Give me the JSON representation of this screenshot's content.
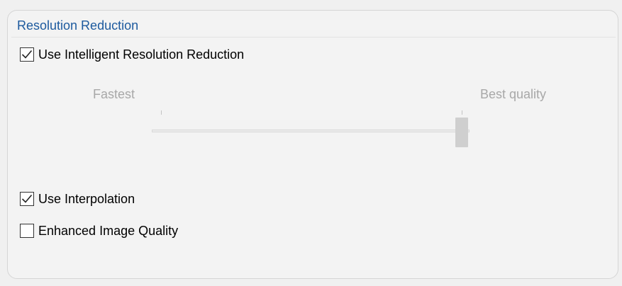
{
  "group": {
    "title": "Resolution Reduction"
  },
  "options": {
    "intelligent_reduction": {
      "label": "Use Intelligent Resolution Reduction",
      "checked": true
    },
    "interpolation": {
      "label": "Use Interpolation",
      "checked": true
    },
    "enhanced_quality": {
      "label": "Enhanced Image Quality",
      "checked": false
    }
  },
  "quality_slider": {
    "min_label": "Fastest",
    "max_label": "Best quality",
    "value": 1.0,
    "enabled": false
  },
  "colors": {
    "group_title": "#1d5a9e",
    "disabled_text": "#a8a8a8"
  }
}
